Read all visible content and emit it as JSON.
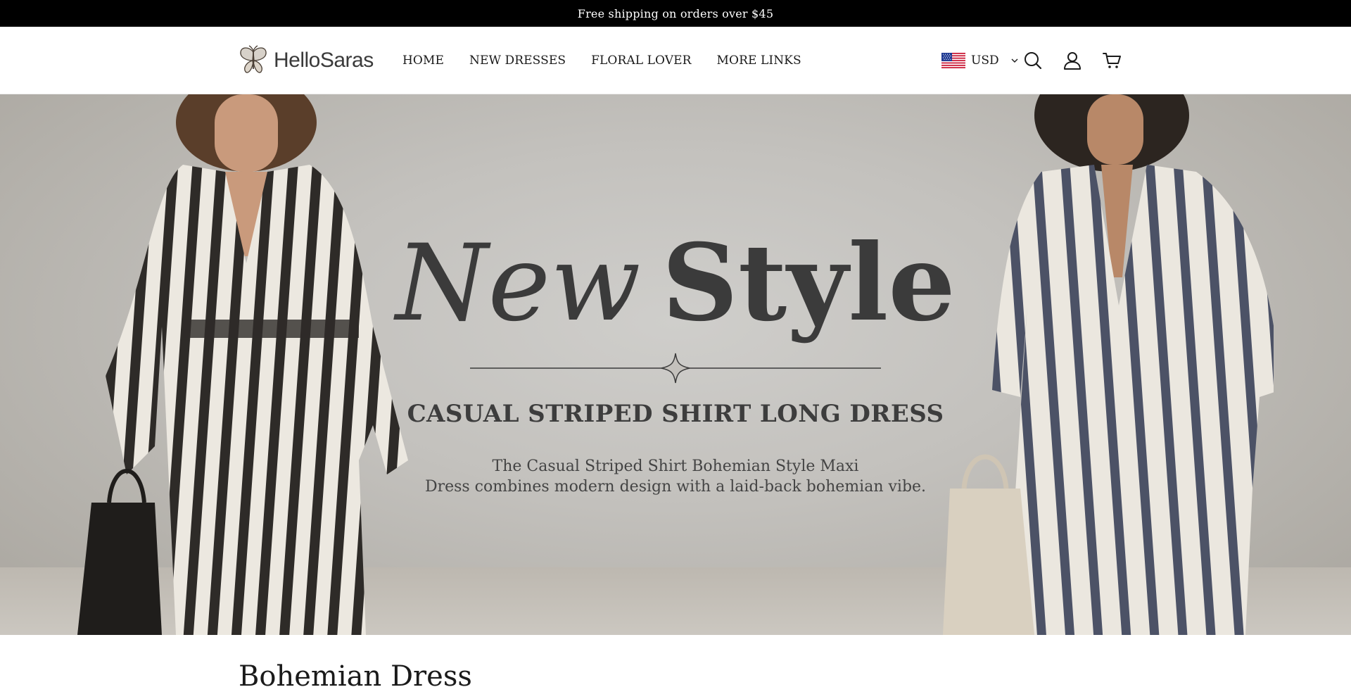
{
  "announcement": {
    "text": "Free shipping on orders over $45"
  },
  "header": {
    "logo_text": "HelloSaras",
    "nav": [
      "HOME",
      "NEW DRESSES",
      "FLORAL LOVER",
      "MORE LINKS"
    ],
    "currency": {
      "selected": "USD",
      "flag": "us-flag-icon"
    },
    "icons": [
      "search-icon",
      "account-icon",
      "cart-icon"
    ]
  },
  "hero": {
    "title_italic": "New",
    "title_bold": "Style",
    "subtitle": "CASUAL STRIPED SHIRT LONG DRESS",
    "description_line1": "The Casual Striped Shirt Bohemian Style Maxi",
    "description_line2": "Dress combines modern design with a laid-back bohemian vibe."
  },
  "section": {
    "title": "Bohemian Dress"
  },
  "colors": {
    "announcement_bg": "#000000",
    "hero_text": "#3b3b3b",
    "background": "#ffffff"
  }
}
